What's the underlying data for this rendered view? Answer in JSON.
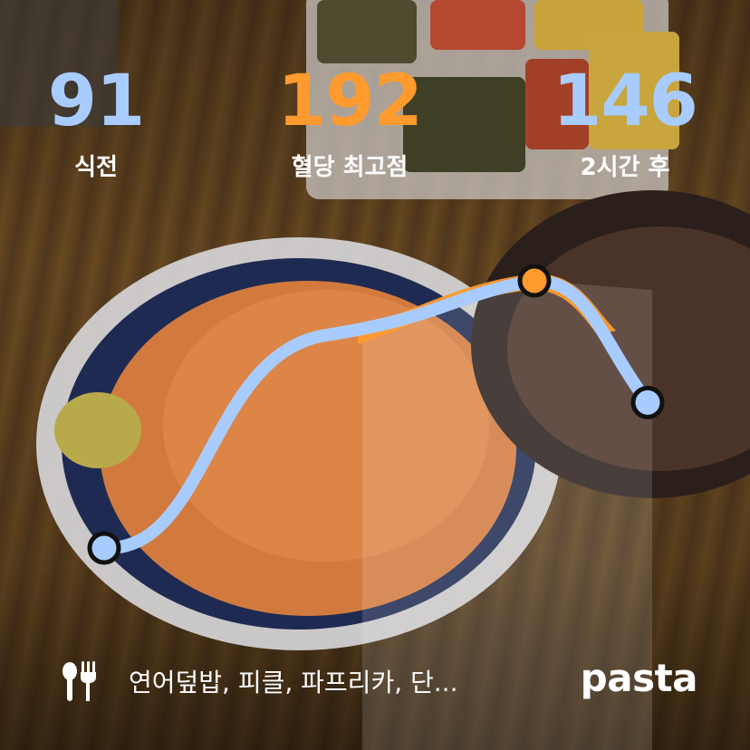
{
  "stats": {
    "fasting": {
      "value": "91",
      "label": "식전",
      "color": "#A9CCFF"
    },
    "peak": {
      "value": "192",
      "label": "혈당 최고점",
      "color": "#FF9A2E"
    },
    "after": {
      "value": "146",
      "label": "2시간 후",
      "color": "#A9CCFF"
    }
  },
  "chart_data": {
    "type": "line",
    "series": [
      {
        "color": "#A9CCFF",
        "values": [
          91,
          192,
          146
        ]
      },
      {
        "color": "#FF9A2E",
        "values": [
          192
        ]
      }
    ],
    "markers": [
      {
        "value": 91,
        "color": "#A9CCFF"
      },
      {
        "value": 192,
        "color": "#FF9A2E"
      },
      {
        "value": 146,
        "color": "#A9CCFF"
      }
    ]
  },
  "footer": {
    "meal_icon": "fork-spoon-icon",
    "meal_text": "연어덮밥, 피클, 파프리카, 단...",
    "brand": "pasta"
  }
}
